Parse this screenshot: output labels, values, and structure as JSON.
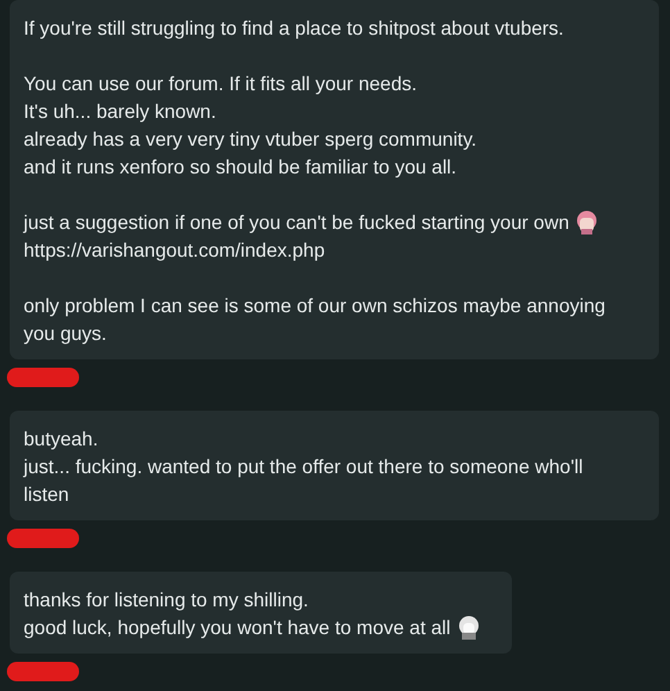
{
  "messages": [
    {
      "redacted": true,
      "paragraphs": [
        [
          {
            "text": "If you're still struggling to find a place to shitpost about vtubers.",
            "emoji": false
          }
        ],
        [
          {
            "text": "You can use our forum. If it fits all your needs.",
            "emoji": false
          },
          {
            "text": "It's uh... barely known.",
            "emoji": false
          },
          {
            "text": "already has a very very tiny vtuber sperg community.",
            "emoji": false
          },
          {
            "text": "and it runs xenforo so should be familiar to you all.",
            "emoji": false
          }
        ],
        [
          {
            "text": "just a suggestion if one of you can't be fucked starting your own",
            "emoji": true
          },
          {
            "text": "https://varishangout.com/index.php",
            "emoji": false
          }
        ],
        [
          {
            "text": "only problem I can see is some of our own schizos maybe annoying you guys.",
            "emoji": false
          }
        ]
      ]
    },
    {
      "redacted": true,
      "paragraphs": [
        [
          {
            "text": "butyeah.",
            "emoji": false
          },
          {
            "text": "just... fucking. wanted to put the offer out there to someone who'll listen",
            "emoji": false
          }
        ]
      ]
    },
    {
      "redacted": true,
      "paragraphs": [
        [
          {
            "text": "thanks for listening to my shilling.",
            "emoji": false
          },
          {
            "text": "good luck, hopefully you won't have to move at all",
            "emoji": true
          }
        ]
      ]
    }
  ]
}
